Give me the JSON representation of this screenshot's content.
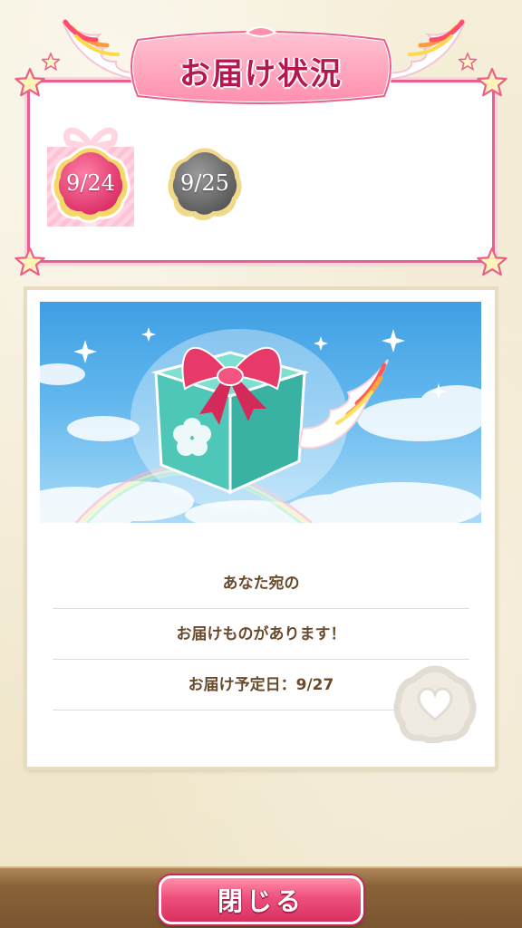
{
  "header": {
    "title": "お届け状況"
  },
  "delivery_status": {
    "dates": [
      {
        "label": "9/24",
        "state": "received",
        "color": "#e8457a"
      },
      {
        "label": "9/25",
        "state": "pending",
        "color": "#7c7c7c"
      }
    ]
  },
  "card": {
    "image": "gift-box-with-wing-in-sky",
    "lines": [
      "あなた宛の",
      "お届けものがあります！",
      "お届け予定日：9/27"
    ]
  },
  "footer": {
    "close_label": "閉じる"
  },
  "colors": {
    "accent_pink": "#e9608d",
    "title_text": "#b5174f",
    "message_text": "#6a4a2c",
    "gift_teal": "#4fc7b8"
  },
  "icons": {
    "badge_shape": "flower-badge-icon",
    "slot_gift": "gift-icon",
    "watermark": "flower-heart-icon",
    "decoration": "star-icon"
  }
}
